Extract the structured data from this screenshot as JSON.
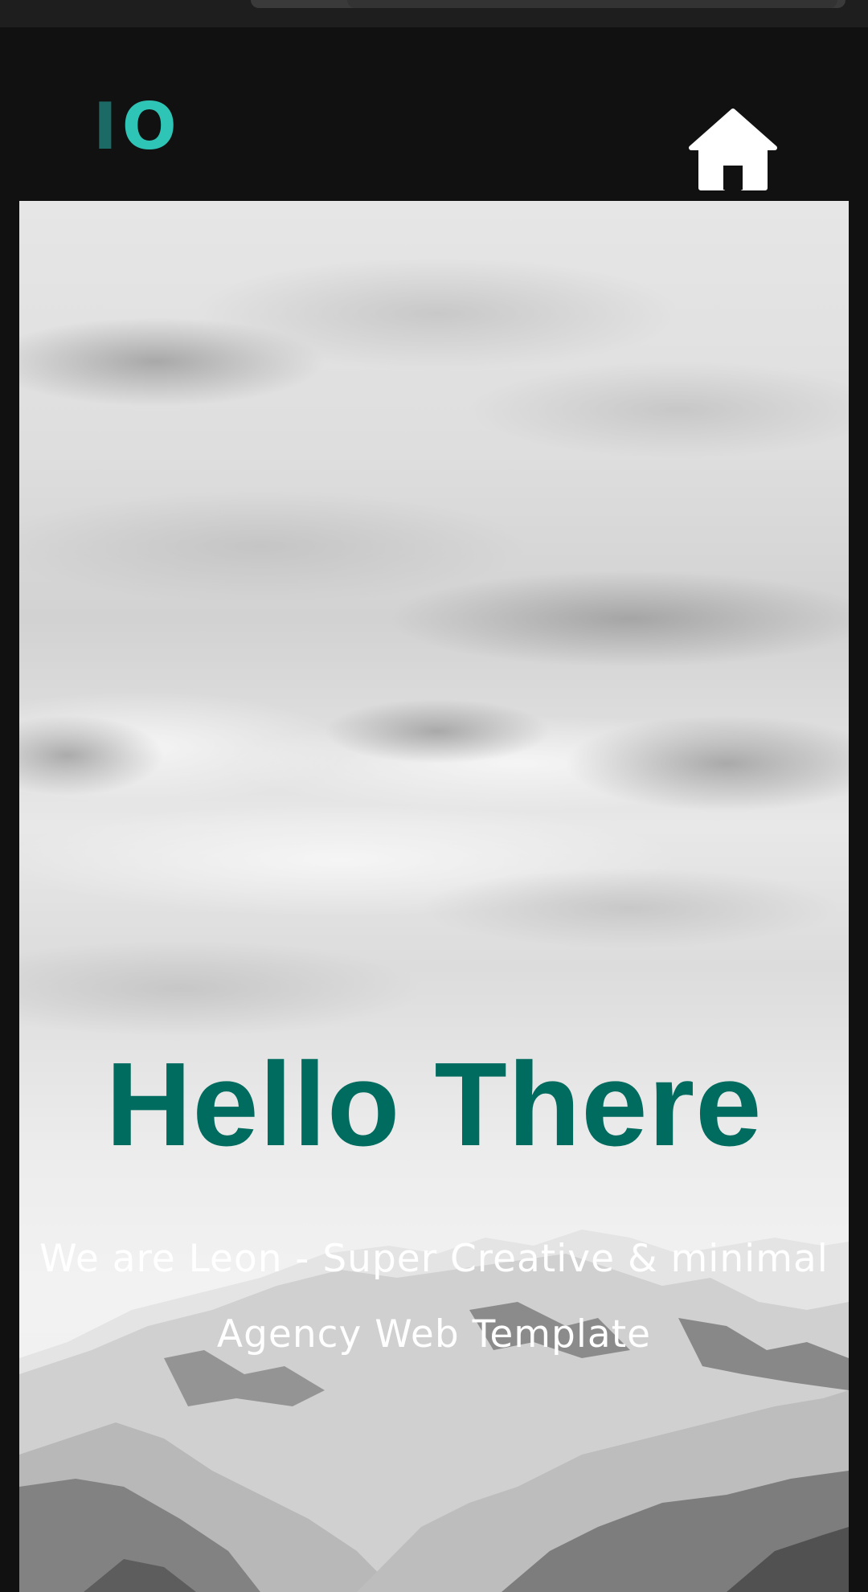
{
  "header": {
    "logo": {
      "letter_one": "I",
      "letter_two": "O"
    },
    "home_icon": "home-icon"
  },
  "hero": {
    "title": "Hello There",
    "subtitle": "We are Leon - Super Creative & minimal Agency Web Template",
    "background": "mountain-landscape-image"
  },
  "colors": {
    "page_background": "#111111",
    "logo_dark": "#1b6a66",
    "logo_light": "#2ec4b6",
    "title": "#006b5f",
    "subtitle": "#ffffff"
  }
}
